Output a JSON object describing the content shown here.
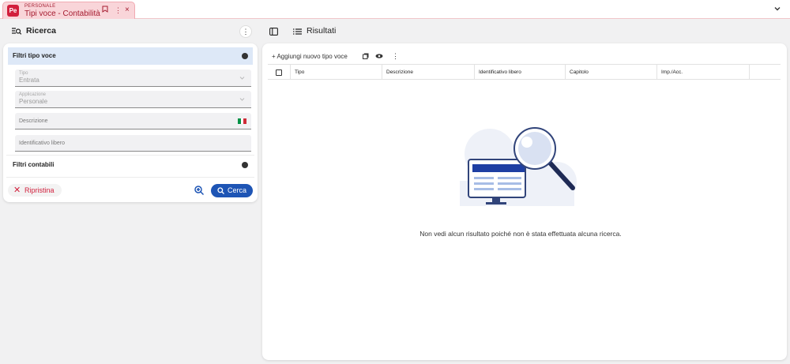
{
  "app": {
    "module_label": "PERSONALE",
    "tab_title": "Tipi voce - Contabilità",
    "logo_text": "Pe",
    "colors": {
      "brand": "#d21f3c",
      "accent": "#1e55b5",
      "tab_bg": "#f9d5d9"
    }
  },
  "search_panel": {
    "title": "Ricerca",
    "section_filters": "Filtri tipo voce",
    "fields": {
      "tipo": {
        "label": "Tipo",
        "value": "Entrata"
      },
      "applicazione": {
        "label": "Applicazione",
        "value": "Personale"
      },
      "descrizione": {
        "placeholder": "Descrizione"
      },
      "identificativo": {
        "placeholder": "Identificativo libero"
      }
    },
    "section_accounting": "Filtri contabili",
    "reset_label": "Ripristina",
    "search_label": "Cerca"
  },
  "results_panel": {
    "title": "Risultati",
    "add_label": "Aggiungi nuovo tipo voce",
    "columns": [
      "Tipo",
      "Descrizione",
      "Identificativo libero",
      "Capitolo",
      "Imp./Acc."
    ],
    "empty_message": "Non vedi alcun risultato poiché non è stata effettuata alcuna ricerca."
  },
  "icons": [
    "bookmark-icon",
    "more-icon",
    "close-icon",
    "chevron-down-icon",
    "search-list-icon",
    "sidebar-toggle-icon",
    "list-icon",
    "copy-icon",
    "eye-icon",
    "zoom-in-icon",
    "search-icon",
    "italian-flag-icon"
  ]
}
